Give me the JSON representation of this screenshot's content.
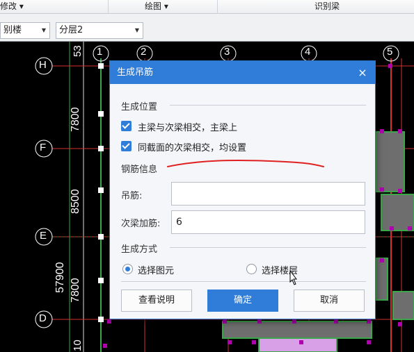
{
  "ribbon": {
    "group1": "修改 ▾",
    "group2": "绘图 ▾",
    "group3": "识别梁"
  },
  "toolbar": {
    "floor_select": "别楼",
    "layer_select": "分层2"
  },
  "canvas": {
    "column_axes": [
      "1",
      "2",
      "3",
      "4",
      "5"
    ],
    "row_axes": [
      "H",
      "F",
      "E",
      "D"
    ],
    "dimensions": [
      "7800",
      "8500",
      "7800",
      "57900"
    ],
    "partial_dimensions": [
      "53",
      "10"
    ]
  },
  "dialog": {
    "title": "生成吊筋",
    "close_glyph": "×",
    "position_section": "生成位置",
    "checkbox1": "主梁与次梁相交，主梁上",
    "checkbox2": "同截面的次梁相交，均设置",
    "rebar_section": "钢筋信息",
    "hanger_label": "吊筋:",
    "hanger_value": "",
    "secondary_label": "次梁加筋:",
    "secondary_value": "6",
    "method_section": "生成方式",
    "radio_element": "选择图元",
    "radio_floor": "选择楼层",
    "radio_selected": "选择图元",
    "btn_help": "查看说明",
    "btn_ok": "确定",
    "btn_cancel": "取消"
  },
  "colors": {
    "accent": "#2f7dd9",
    "canvas_bg": "#000000",
    "axis_line": "#d43030",
    "beam_green": "#3aa84a",
    "annotation_red": "#e02020"
  }
}
